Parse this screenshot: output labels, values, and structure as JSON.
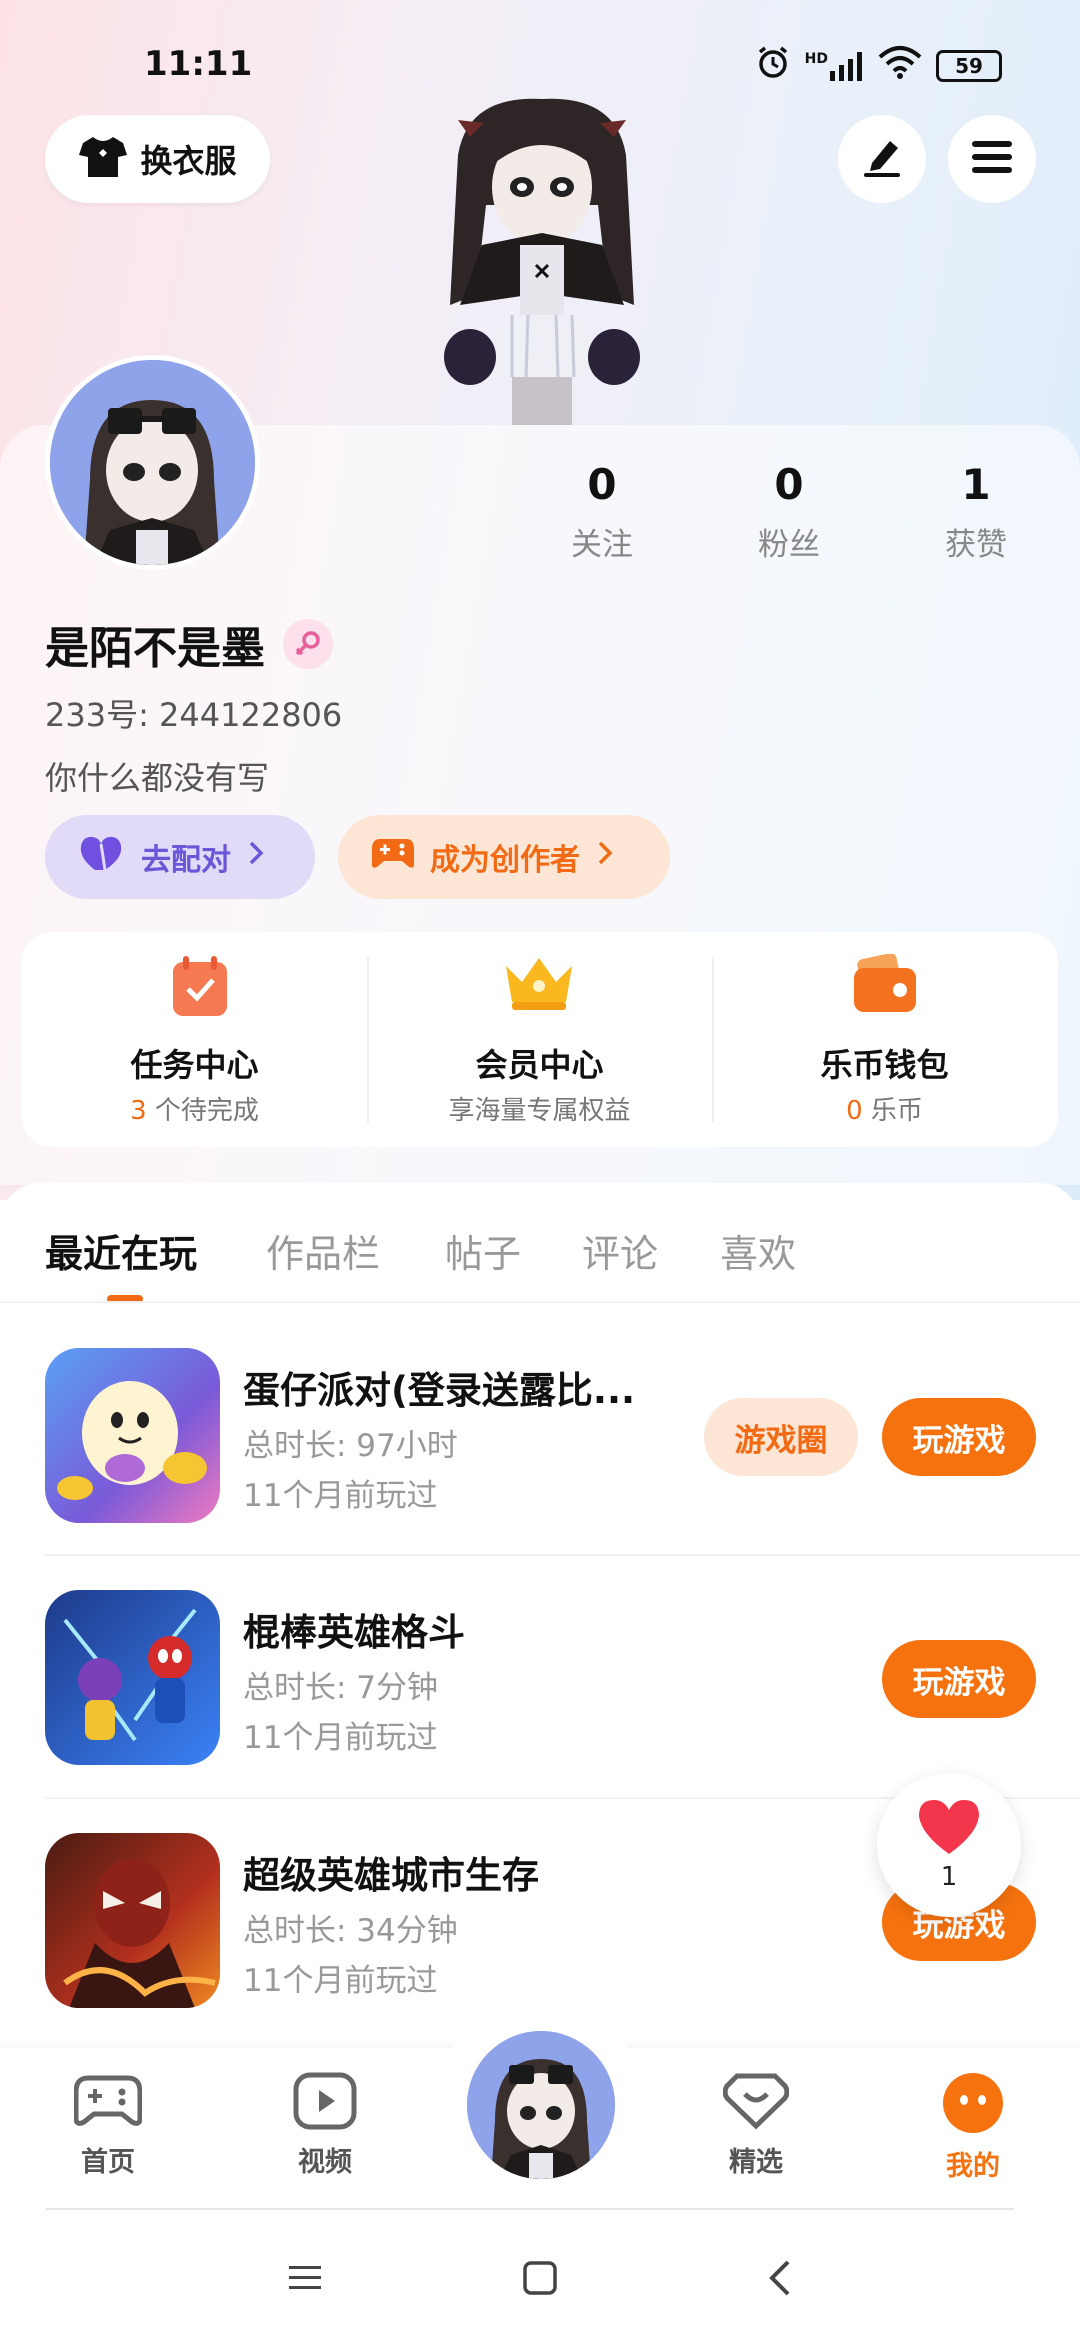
{
  "status_bar": {
    "time": "11:11",
    "network": "HD",
    "battery": "59"
  },
  "header": {
    "outfit_label": "换衣服"
  },
  "profile": {
    "nickname": "是陌不是墨",
    "uid_text": "233号: 244122806",
    "bio": "你什么都没有写",
    "stats": [
      {
        "value": "0",
        "label": "关注"
      },
      {
        "value": "0",
        "label": "粉丝"
      },
      {
        "value": "1",
        "label": "获赞"
      }
    ],
    "match_label": "去配对",
    "creator_label": "成为创作者"
  },
  "quick_actions": [
    {
      "title": "任务中心",
      "sub_highlight": "3",
      "sub_text": " 个待完成"
    },
    {
      "title": "会员中心",
      "sub_highlight": "",
      "sub_text": "享海量专属权益"
    },
    {
      "title": "乐币钱包",
      "sub_highlight": "0",
      "sub_text": " 乐币"
    }
  ],
  "tabs": [
    "最近在玩",
    "作品栏",
    "帖子",
    "评论",
    "喜欢"
  ],
  "games": [
    {
      "name": "蛋仔派对(登录送露比...",
      "duration": "总时长: 97小时",
      "last_played": "11个月前玩过",
      "circle_label": "游戏圈",
      "play_label": "玩游戏"
    },
    {
      "name": "棍棒英雄格斗",
      "duration": "总时长: 7分钟",
      "last_played": "11个月前玩过",
      "play_label": "玩游戏"
    },
    {
      "name": "超级英雄城市生存",
      "duration": "总时长: 34分钟",
      "last_played": "11个月前玩过",
      "play_label": "玩游戏"
    }
  ],
  "like_count": "1",
  "bottom_nav": [
    {
      "label": "首页",
      "icon": "gamepad-icon"
    },
    {
      "label": "视频",
      "icon": "video-icon"
    },
    {
      "label": "精选",
      "icon": "heart-badge-icon"
    },
    {
      "label": "我的",
      "icon": "profile-face-icon"
    }
  ],
  "colors": {
    "accent": "#f6720f",
    "match": "#6d55d8"
  }
}
